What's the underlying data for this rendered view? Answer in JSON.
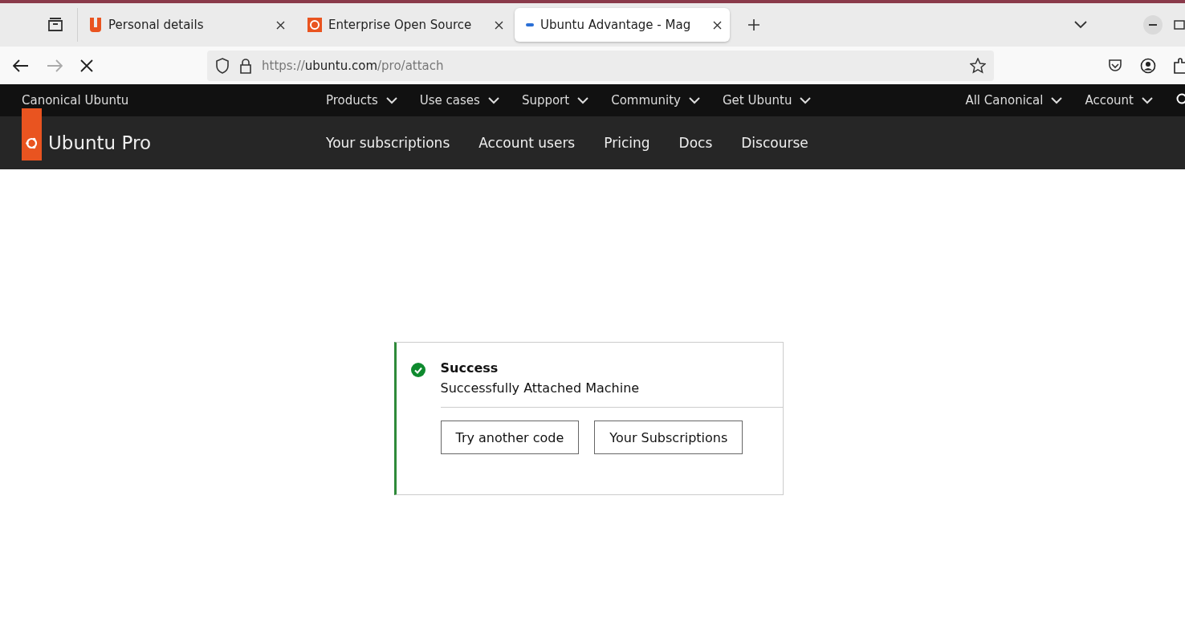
{
  "tabs": [
    {
      "label": "Personal details",
      "selected": false
    },
    {
      "label": "Enterprise Open Source",
      "selected": false
    },
    {
      "label": "Ubuntu Advantage - Mag",
      "selected": true
    }
  ],
  "address": {
    "scheme": "https://",
    "host": "ubuntu.com",
    "path": "/pro/attach"
  },
  "top_nav": {
    "brand": "Canonical Ubuntu",
    "items": [
      "Products",
      "Use cases",
      "Support",
      "Community",
      "Get Ubuntu"
    ],
    "right_items": [
      "All Canonical",
      "Account"
    ]
  },
  "sub_nav": {
    "brand": "Ubuntu Pro",
    "items": [
      "Your subscriptions",
      "Account users",
      "Pricing",
      "Docs",
      "Discourse"
    ]
  },
  "notification": {
    "title": "Success",
    "message": "Successfully Attached Machine",
    "buttons": [
      "Try another code",
      "Your Subscriptions"
    ]
  }
}
